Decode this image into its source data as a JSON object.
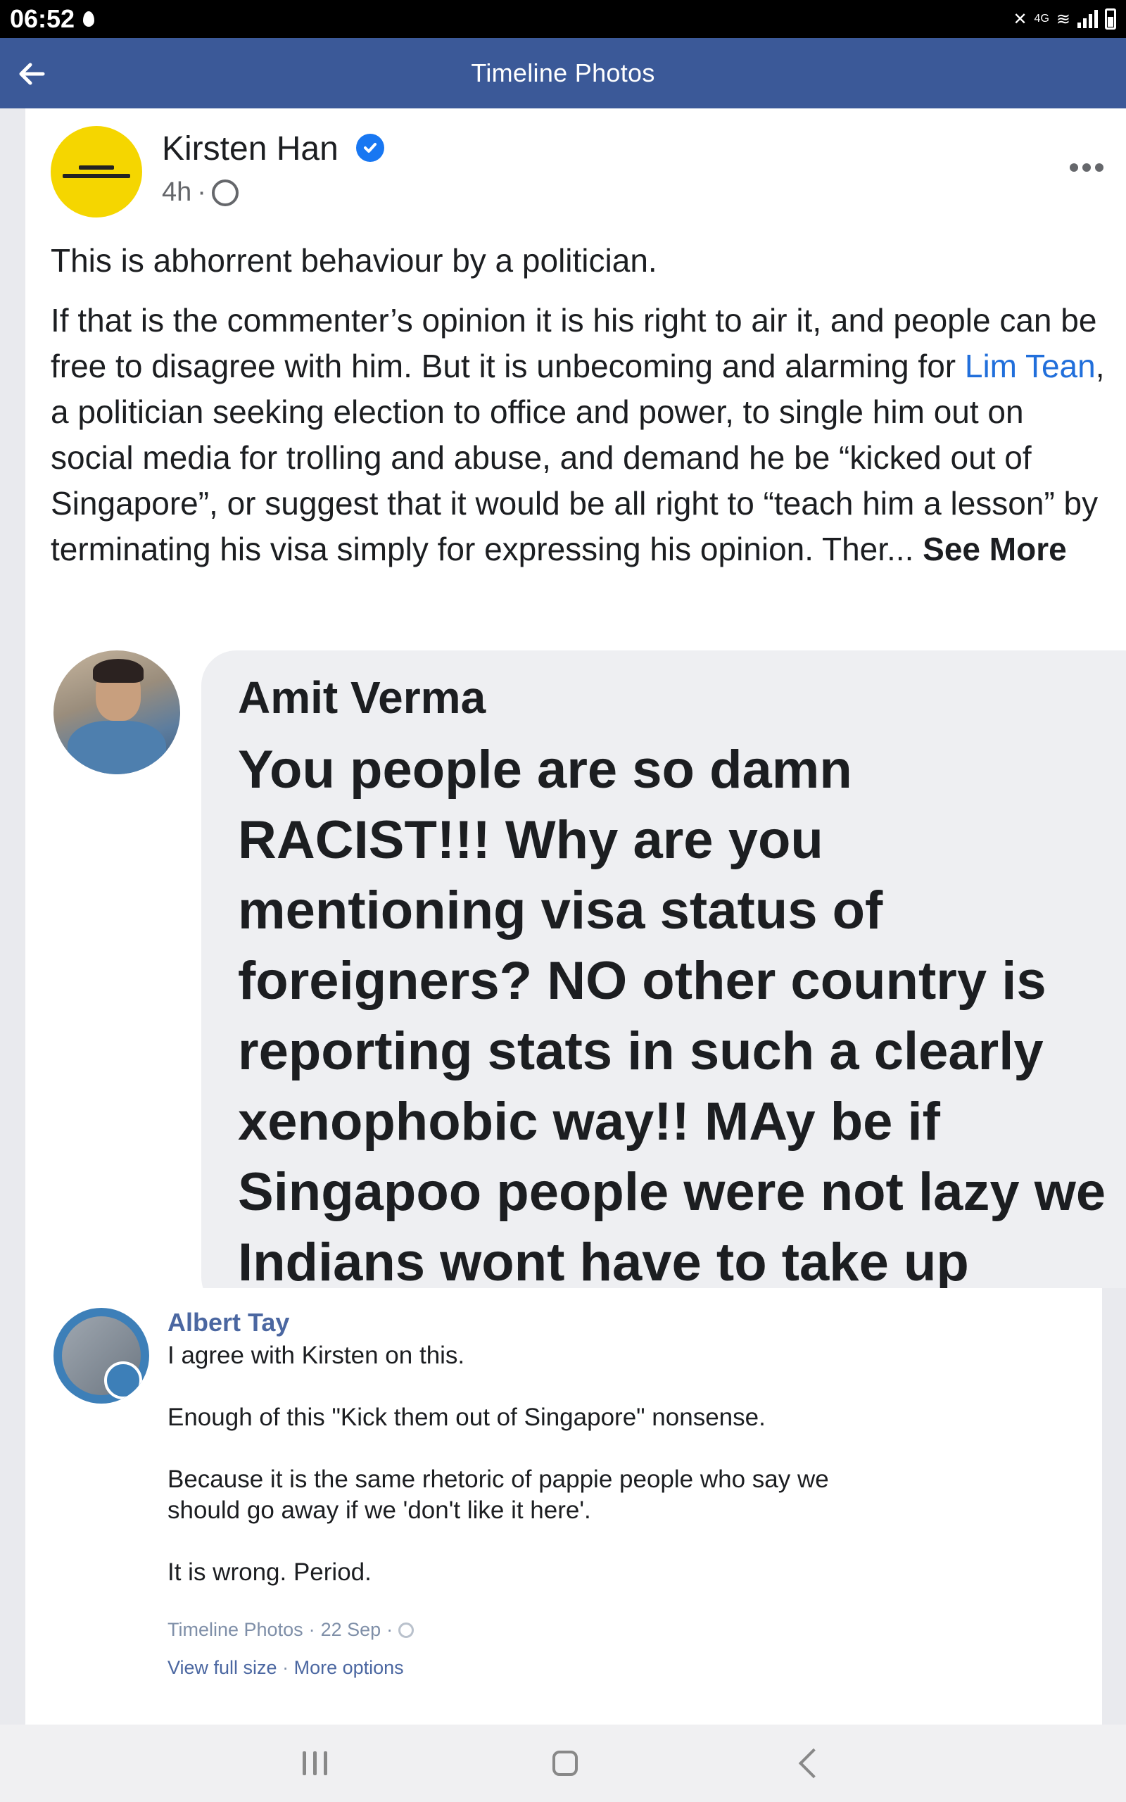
{
  "status_bar": {
    "time": "06:52",
    "network": "4G",
    "icons": [
      "drop-icon",
      "mute-icon",
      "wifi-icon",
      "signal-icon",
      "battery-icon"
    ]
  },
  "app_bar": {
    "title": "Timeline Photos",
    "back_icon": "arrow-left-icon"
  },
  "post": {
    "author": "Kirsten Han",
    "verified_icon": "verified-badge-icon",
    "time": "4h",
    "separator": "·",
    "paragraph1": "This is abhorrent behaviour by a politician.",
    "paragraph2_part1": "If that is the commenter’s opinion it is his right to air it, and people can be free to disagree with him. But it is unbecoming and alarming for ",
    "mention": "Lim Tean",
    "paragraph2_part2": ", a politician seeking election to office and power, to single him out on social media for trolling and abuse, and demand he be “kicked out of Singapore”, or suggest that it would be all right to “teach him a lesson” by terminating his visa simply for expressing his opinion. Ther... ",
    "see_more": "See More"
  },
  "screenshot_comment": {
    "name": "Amit Verma",
    "text": "You people are so damn RACIST!!! Why are you mentioning visa status of foreigners? NO other country is reporting stats in such a clearly xenophobic way!! MAy be if Singapoo people were not lazy we Indians wont have to take up"
  },
  "comment": {
    "name": "Albert Tay",
    "text": "I agree with Kirsten on this.\n\nEnough of this \"Kick them out of Singapore\" nonsense.\n\nBecause it is the same rhetoric of pappie people who say we\nshould go away if we 'don't like it here'.\n\nIt is wrong. Period.",
    "meta_source": "Timeline Photos",
    "meta_sep": " · ",
    "meta_date": "22 Sep",
    "meta_sep2": " ·",
    "link_full_size": "View full size",
    "link_sep": " · ",
    "link_more": "More options"
  },
  "colors": {
    "app_bar": "#3b5998",
    "link": "#216fdb",
    "comment_name": "#4b67a1",
    "verified": "#1877f2"
  }
}
